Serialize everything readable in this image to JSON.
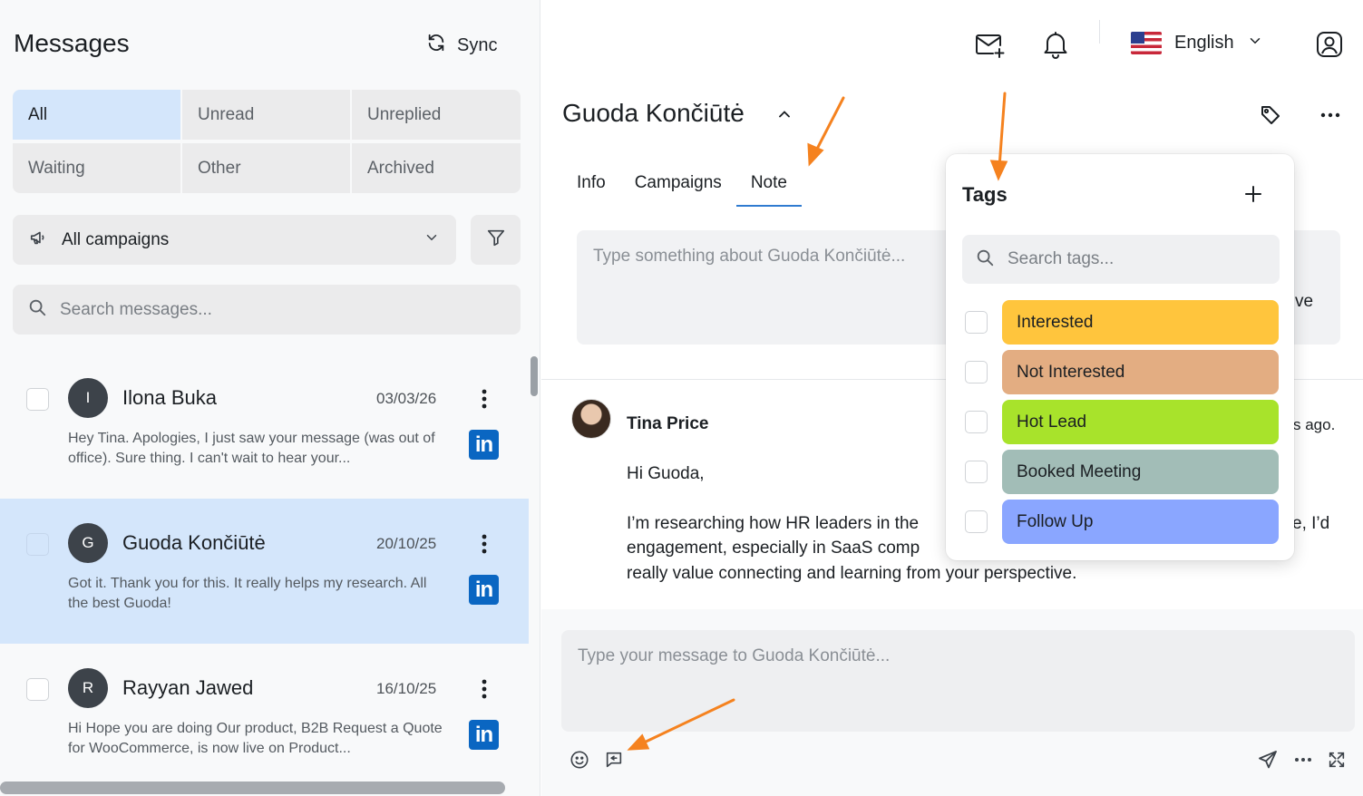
{
  "sidebar": {
    "title": "Messages",
    "sync_label": "Sync",
    "filters": [
      "All",
      "Unread",
      "Unreplied",
      "Waiting",
      "Other",
      "Archived"
    ],
    "active_filter": "All",
    "campaign_select": "All campaigns",
    "search_placeholder": "Search messages..."
  },
  "conversations": [
    {
      "initial": "I",
      "name": "Ilona Buka",
      "date": "03/03/26",
      "preview": "Hey Tina. Apologies, I just saw your message (was out of office). Sure thing. I can't wait to hear your...",
      "channel": "in"
    },
    {
      "initial": "G",
      "name": "Guoda Končiūtė",
      "date": "20/10/25",
      "preview": "Got it. Thank you for this. It really helps my research. All the best Guoda!",
      "channel": "in",
      "selected": true
    },
    {
      "initial": "R",
      "name": "Rayyan Jawed",
      "date": "16/10/25",
      "preview": "Hi Hope you are doing Our product, B2B Request a Quote for WooCommerce, is now live on Product...",
      "channel": "in"
    }
  ],
  "topbar": {
    "language": "English"
  },
  "contact": {
    "name": "Guoda Končiūtė",
    "tabs": [
      "Info",
      "Campaigns",
      "Note"
    ],
    "active_tab": "Note",
    "note_placeholder": "Type something about Guoda Končiūtė...",
    "partial_text": "ve"
  },
  "message": {
    "sender": "Tina Price",
    "time_partial": "s ago.",
    "greeting": "Hi Guoda,",
    "body_line1": "I’m researching how HR leaders in the",
    "body_line1_end": "e, I’d",
    "body_line2": "engagement, especially in SaaS comp",
    "body_line3": "really value connecting and learning from your perspective."
  },
  "composer": {
    "placeholder": "Type your message to Guoda Končiūtė..."
  },
  "tags_popover": {
    "title": "Tags",
    "search_placeholder": "Search tags...",
    "tags": [
      {
        "label": "Interested",
        "color": "#ffc53d"
      },
      {
        "label": "Not Interested",
        "color": "#e3ad82"
      },
      {
        "label": "Hot Lead",
        "color": "#a8e32b"
      },
      {
        "label": "Booked Meeting",
        "color": "#a2bdb7"
      },
      {
        "label": "Follow Up",
        "color": "#8aa6ff"
      }
    ]
  },
  "colors": {
    "accent": "#2f7bd0",
    "selected_bg": "#d4e6fb",
    "linkedin": "#0a66c2",
    "annotation_arrow": "#f5821f"
  }
}
